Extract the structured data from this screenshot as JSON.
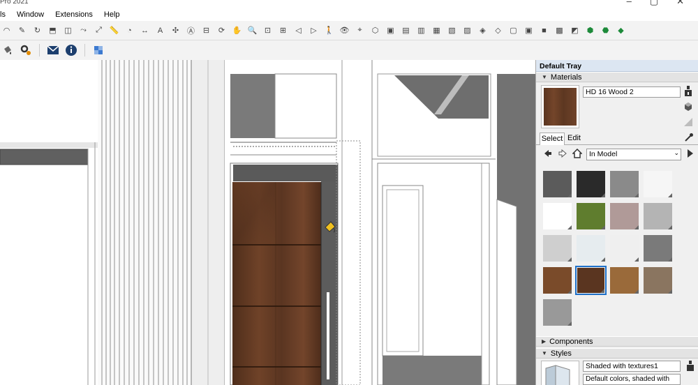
{
  "window": {
    "title_partial": "Pro 2021"
  },
  "menubar": {
    "items": [
      "ls",
      "Window",
      "Extensions",
      "Help"
    ]
  },
  "toolbar1": {
    "icons": [
      "arc-icon",
      "freehand-icon",
      "rotate-icon",
      "pushpull-icon",
      "offset-icon",
      "followme-icon",
      "scale-icon",
      "tape-icon",
      "protractor-icon",
      "dimension-icon",
      "text-icon",
      "axes-icon",
      "3dtext-icon",
      "section-icon",
      "orbit-icon",
      "pan-icon",
      "zoom-icon",
      "zoomwindow-icon",
      "zoomextents-icon",
      "previous-icon",
      "next-icon",
      "walk-icon",
      "lookaround-icon",
      "position-camera-icon",
      "iso-icon",
      "top-icon",
      "front-icon",
      "right-icon",
      "back-icon",
      "left-icon",
      "bottom-icon",
      "xray-icon",
      "backedges-icon",
      "wireframe-icon",
      "hiddenline-icon",
      "shaded-icon",
      "textured-icon",
      "monochrome-icon",
      "warehouse-icon",
      "extension-warehouse-icon",
      "layout-icon"
    ]
  },
  "toolbar2": {
    "icons": [
      "paint-bucket-icon",
      "settings-icon",
      "message-icon",
      "info-icon",
      "component-icon"
    ]
  },
  "tray": {
    "title": "Default Tray",
    "materials": {
      "header": "Materials",
      "current_name": "HD 16 Wood 2",
      "tabs": [
        "Select",
        "Edit"
      ],
      "collection": "In Model",
      "swatches": [
        {
          "color": "#5b5b5b",
          "selected": false
        },
        {
          "color": "#2a2a2a",
          "selected": false
        },
        {
          "color": "#8a8a8a",
          "selected": false
        },
        {
          "color": "#f6f6f6",
          "selected": false
        },
        {
          "color": "#ffffff",
          "selected": false
        },
        {
          "color": "#5f7d2e",
          "selected": false
        },
        {
          "color": "#b09a98",
          "selected": false
        },
        {
          "color": "#b4b4b4",
          "selected": false
        },
        {
          "color": "#cfcfcf",
          "selected": false
        },
        {
          "color": "#e6ecef",
          "selected": false
        },
        {
          "color": "#efefef",
          "selected": false
        },
        {
          "color": "#7a7a7a",
          "selected": false
        },
        {
          "color": "#7a4b2a",
          "selected": false
        },
        {
          "color": "#5a3520",
          "selected": true
        },
        {
          "color": "#9a6a3a",
          "selected": false
        },
        {
          "color": "#8a7560",
          "selected": false
        },
        {
          "color": "#999999",
          "selected": false
        }
      ]
    },
    "components": {
      "header": "Components"
    },
    "styles": {
      "header": "Styles",
      "current_name": "Shaded with textures1",
      "description": "Default colors, shaded with"
    }
  },
  "colors": {
    "tray_title_bg": "#dce6f2",
    "wood": "#5a3520",
    "selection": "#1e70c8"
  }
}
